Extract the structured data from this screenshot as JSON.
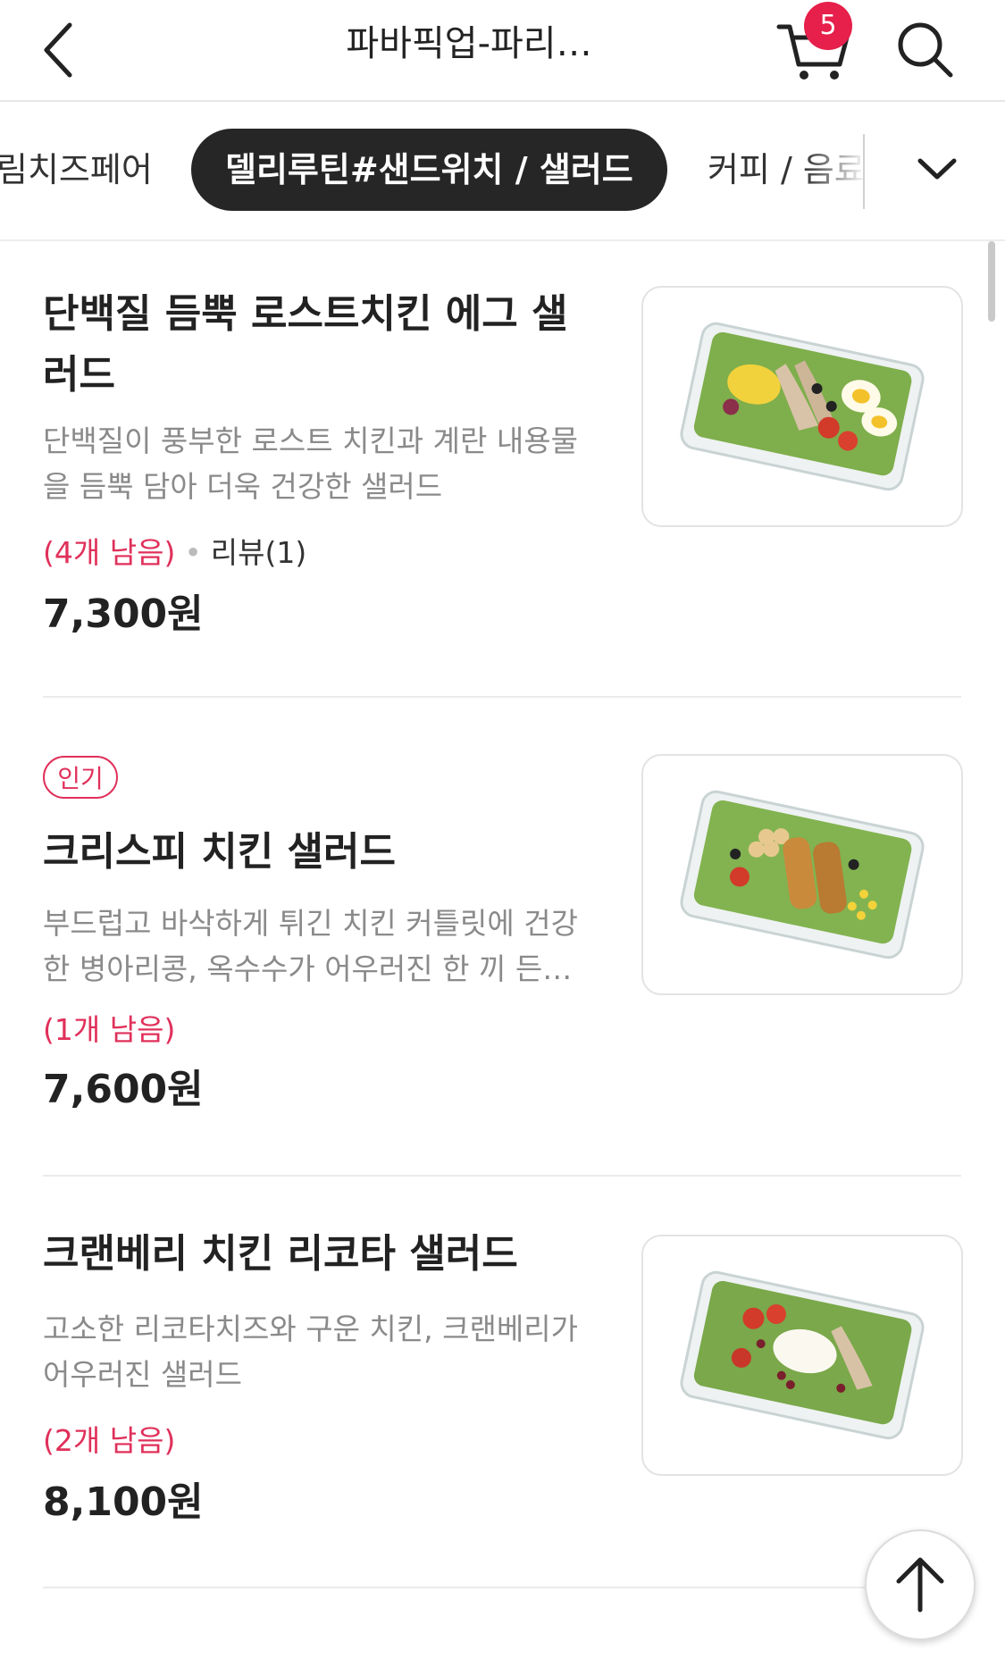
{
  "header": {
    "title": "파바픽업-파리…",
    "cart_count": "5"
  },
  "tabs": {
    "left_partial": "림치즈페어",
    "active": "델리루틴#샌드위치 / 샐러드",
    "right_partial": "커피 / 음료"
  },
  "products": [
    {
      "name": "단백질 듬뿍 로스트치킨 에그 샐러드",
      "description": "단백질이 풍부한 로스트 치킨과 계란 내용물을 듬뿍 담아 더욱 건강한 샐러드",
      "stock": "(4개 남음)",
      "review": "리뷰(1)",
      "price": "7,300원",
      "badge": ""
    },
    {
      "name": "크리스피 치킨 샐러드",
      "description": "부드럽고 바삭하게 튀긴 치킨 커틀릿에 건강한 병아리콩, 옥수수가 어우러진 한 끼 든든한 샐러드",
      "stock": "(1개 남음)",
      "review": "",
      "price": "7,600원",
      "badge": "인기"
    },
    {
      "name": "크랜베리 치킨 리코타 샐러드",
      "description": "고소한 리코타치즈와 구운 치킨, 크랜베리가 어우러진 샐러드",
      "stock": "(2개 남음)",
      "review": "",
      "price": "8,100원",
      "badge": ""
    }
  ],
  "colors": {
    "accent": "#e0305a",
    "badge_red": "#e61f4b",
    "active_tab_bg": "#262626"
  },
  "icons": [
    "back-arrow-icon",
    "cart-icon",
    "search-icon",
    "chevron-down-icon",
    "arrow-up-icon"
  ]
}
